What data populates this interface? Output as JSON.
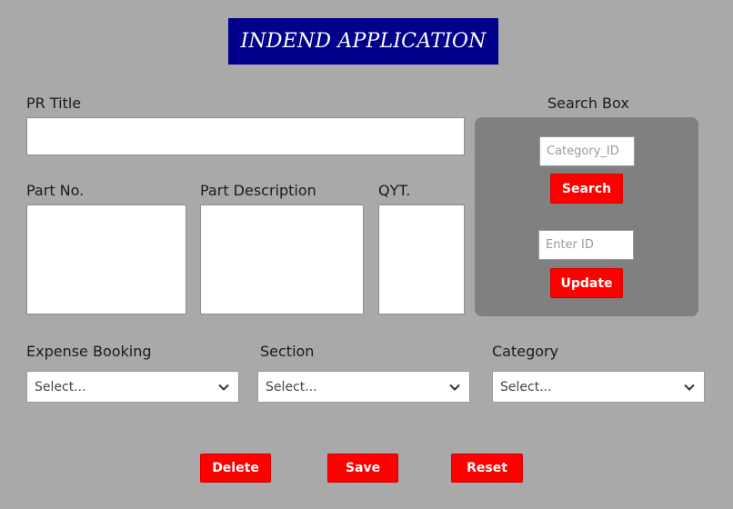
{
  "title": "INDEND APPLICATION",
  "form": {
    "pr_title_label": "PR Title",
    "pr_title_value": "",
    "part_no_label": "Part No.",
    "part_no_value": "",
    "part_desc_label": "Part Description",
    "part_desc_value": "",
    "qty_label": "QYT.",
    "qty_value": "",
    "expense_label": "Expense Booking",
    "expense_value": "Select...",
    "section_label": "Section",
    "section_value": "Select...",
    "category_label": "Category",
    "category_value": "Select..."
  },
  "search": {
    "heading": "Search Box",
    "category_placeholder": "Category_ID",
    "search_button": "Search",
    "id_placeholder": "Enter ID",
    "update_button": "Update"
  },
  "actions": {
    "delete": "Delete",
    "save": "Save",
    "reset": "Reset"
  },
  "colors": {
    "background": "#a9a9a9",
    "title_bg": "#00008b",
    "button_red": "#ff0000",
    "panel_gray": "#808080"
  },
  "icons": {
    "select_chevron": "chevron-down-icon"
  }
}
